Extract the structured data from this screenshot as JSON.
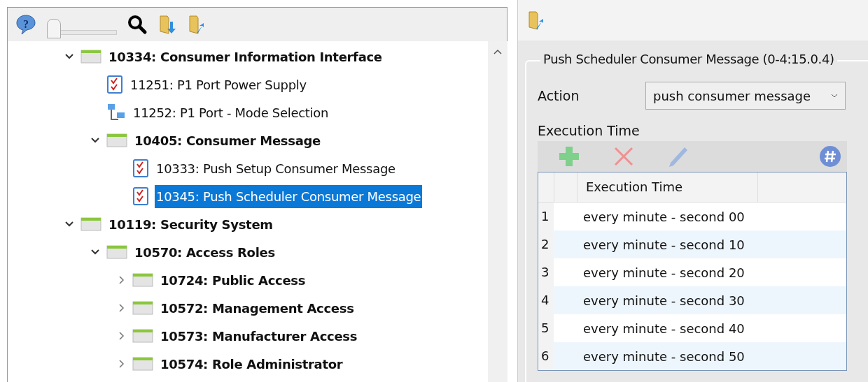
{
  "left_toolbar": {
    "help_glyph": "?",
    "slider": {
      "level": 0
    }
  },
  "tree": [
    {
      "label": "10334: Consumer Information Interface",
      "kind": "module",
      "expanded": true,
      "selected": false,
      "children": [
        {
          "label": "11251: P1 Port Power Supply",
          "kind": "checklist",
          "selected": false
        },
        {
          "label": "11252: P1 Port - Mode Selection",
          "kind": "network",
          "selected": false
        },
        {
          "label": "10405: Consumer Message",
          "kind": "module",
          "expanded": true,
          "selected": false,
          "children": [
            {
              "label": "10333: Push Setup Consumer Message",
              "kind": "checklist",
              "selected": false
            },
            {
              "label": "10345: Push Scheduler Consumer Message",
              "kind": "checklist",
              "selected": true
            }
          ]
        }
      ]
    },
    {
      "label": "10119: Security System",
      "kind": "module",
      "expanded": true,
      "selected": false,
      "children": [
        {
          "label": "10570: Access Roles",
          "kind": "module",
          "expanded": true,
          "selected": false,
          "children": [
            {
              "label": "10724: Public Access",
              "kind": "module",
              "expanded": false,
              "selected": false
            },
            {
              "label": "10572: Management Access",
              "kind": "module",
              "expanded": false,
              "selected": false
            },
            {
              "label": "10573: Manufacturer Access",
              "kind": "module",
              "expanded": false,
              "selected": false
            },
            {
              "label": "10574: Role Administrator",
              "kind": "module",
              "expanded": false,
              "selected": false
            }
          ]
        }
      ]
    }
  ],
  "details": {
    "title": "Push Scheduler Consumer Message (0-4:15.0.4)",
    "action_label": "Action",
    "action_value": "push consumer message",
    "section_label": "Execution Time",
    "table": {
      "columns": [
        "Execution Time"
      ],
      "rows": [
        {
          "number": "1",
          "value": "every minute - second 00"
        },
        {
          "number": "2",
          "value": "every minute - second 10"
        },
        {
          "number": "3",
          "value": "every minute - second 20"
        },
        {
          "number": "4",
          "value": "every minute - second 30"
        },
        {
          "number": "5",
          "value": "every minute - second 40"
        },
        {
          "number": "6",
          "value": "every minute - second 50"
        }
      ]
    }
  }
}
